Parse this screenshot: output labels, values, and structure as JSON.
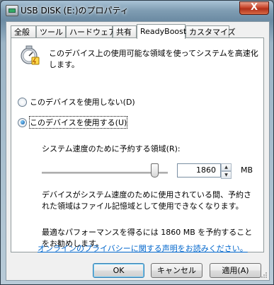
{
  "window": {
    "title": "USB DISK (E:)のプロパティ",
    "close_label": "X"
  },
  "tabs": [
    {
      "label": "全般"
    },
    {
      "label": "ツール"
    },
    {
      "label": "ハードウェア"
    },
    {
      "label": "共有"
    },
    {
      "label": "ReadyBoost"
    },
    {
      "label": "カスタマイズ"
    }
  ],
  "active_tab": "ReadyBoost",
  "readyboost": {
    "description": "このデバイス上の使用可能な領域を使ってシステムを高速化します。",
    "option_disable": "このデバイスを使用しない(D)",
    "option_enable": "このデバイスを使用する(U)",
    "selected_option": "enable",
    "reserve_label": "システム速度のために予約する領域(R):",
    "reserve_value": "1860",
    "unit": "MB",
    "slider_fraction": 0.93,
    "note": "デバイスがシステム速度のために使用されている間、予約された領域はファイル記憶域として使用できなくなります。",
    "recommendation": "最適なパフォーマンスを得るには 1860 MB を予約することをお勧めします。",
    "privacy_link": "オンラインのプライバシーに関する声明をお読みください。"
  },
  "buttons": {
    "ok": "OK",
    "cancel": "キャンセル",
    "apply": "適用(A)"
  },
  "colors": {
    "link": "#0066cc",
    "close_button": "#c8452c"
  }
}
